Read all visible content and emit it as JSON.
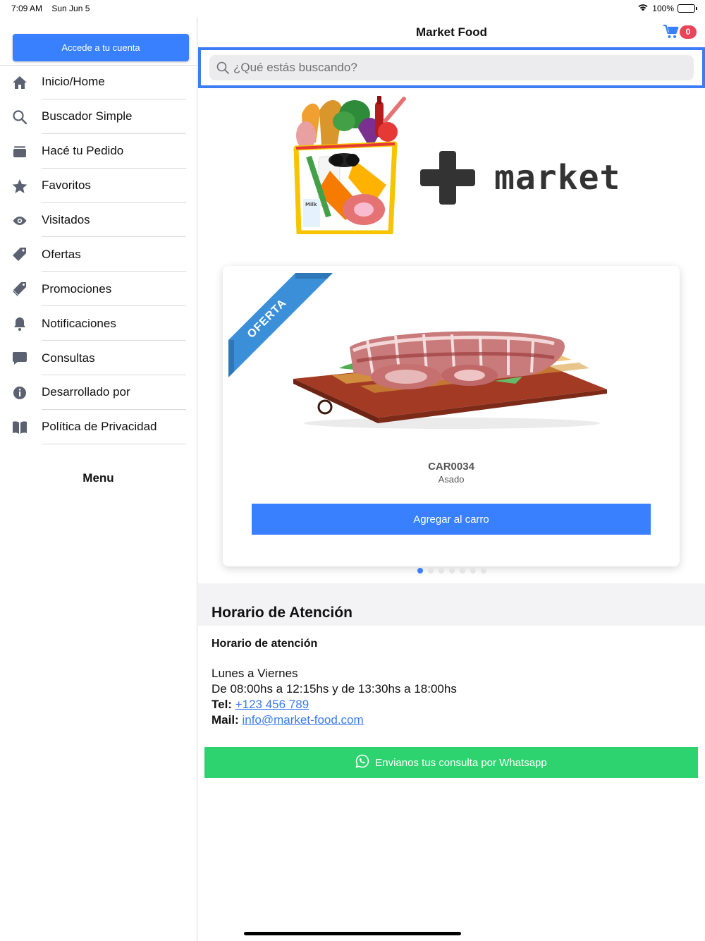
{
  "status": {
    "time": "7:09 AM",
    "date": "Sun Jun 5",
    "battery": "100%"
  },
  "sidebar": {
    "login_label": "Accede a tu cuenta",
    "items": [
      {
        "label": "Inicio/Home",
        "icon": "home-icon"
      },
      {
        "label": "Buscador Simple",
        "icon": "search-icon"
      },
      {
        "label": "Hacé tu Pedido",
        "icon": "archive-icon"
      },
      {
        "label": "Favoritos",
        "icon": "star-icon"
      },
      {
        "label": "Visitados",
        "icon": "eye-icon"
      },
      {
        "label": "Ofertas",
        "icon": "pricetag-icon"
      },
      {
        "label": "Promociones",
        "icon": "pricetags-icon"
      },
      {
        "label": "Notificaciones",
        "icon": "bell-icon"
      },
      {
        "label": "Consultas",
        "icon": "chat-icon"
      },
      {
        "label": "Desarrollado por",
        "icon": "info-icon"
      },
      {
        "label": "Política de Privacidad",
        "icon": "book-icon"
      }
    ],
    "menu_title": "Menu"
  },
  "header": {
    "title": "Market Food",
    "cart_count": "0"
  },
  "search": {
    "placeholder": "¿Qué estás buscando?"
  },
  "logo": {
    "text": "market",
    "bag_label": "Milk"
  },
  "product": {
    "ribbon": "OFERTA",
    "code": "CAR0034",
    "name": "Asado",
    "add_label": "Agregar al carro"
  },
  "carousel": {
    "pages": 7,
    "active_page": 1
  },
  "hours": {
    "section_title": "Horario de Atención",
    "title": "Horario de atención",
    "days": "Lunes a Viernes",
    "times": "De 08:00hs a 12:15hs y de 13:30hs a 18:00hs",
    "tel_label": "Tel:",
    "tel": "+123 456 789",
    "mail_label": "Mail:",
    "mail": "info@market-food.com"
  },
  "whatsapp": {
    "label": "Envianos tus consulta por Whatsapp"
  },
  "colors": {
    "primary": "#3880ff",
    "success": "#2dd36f",
    "danger": "#eb445a",
    "focus": "#3e7cf4"
  }
}
